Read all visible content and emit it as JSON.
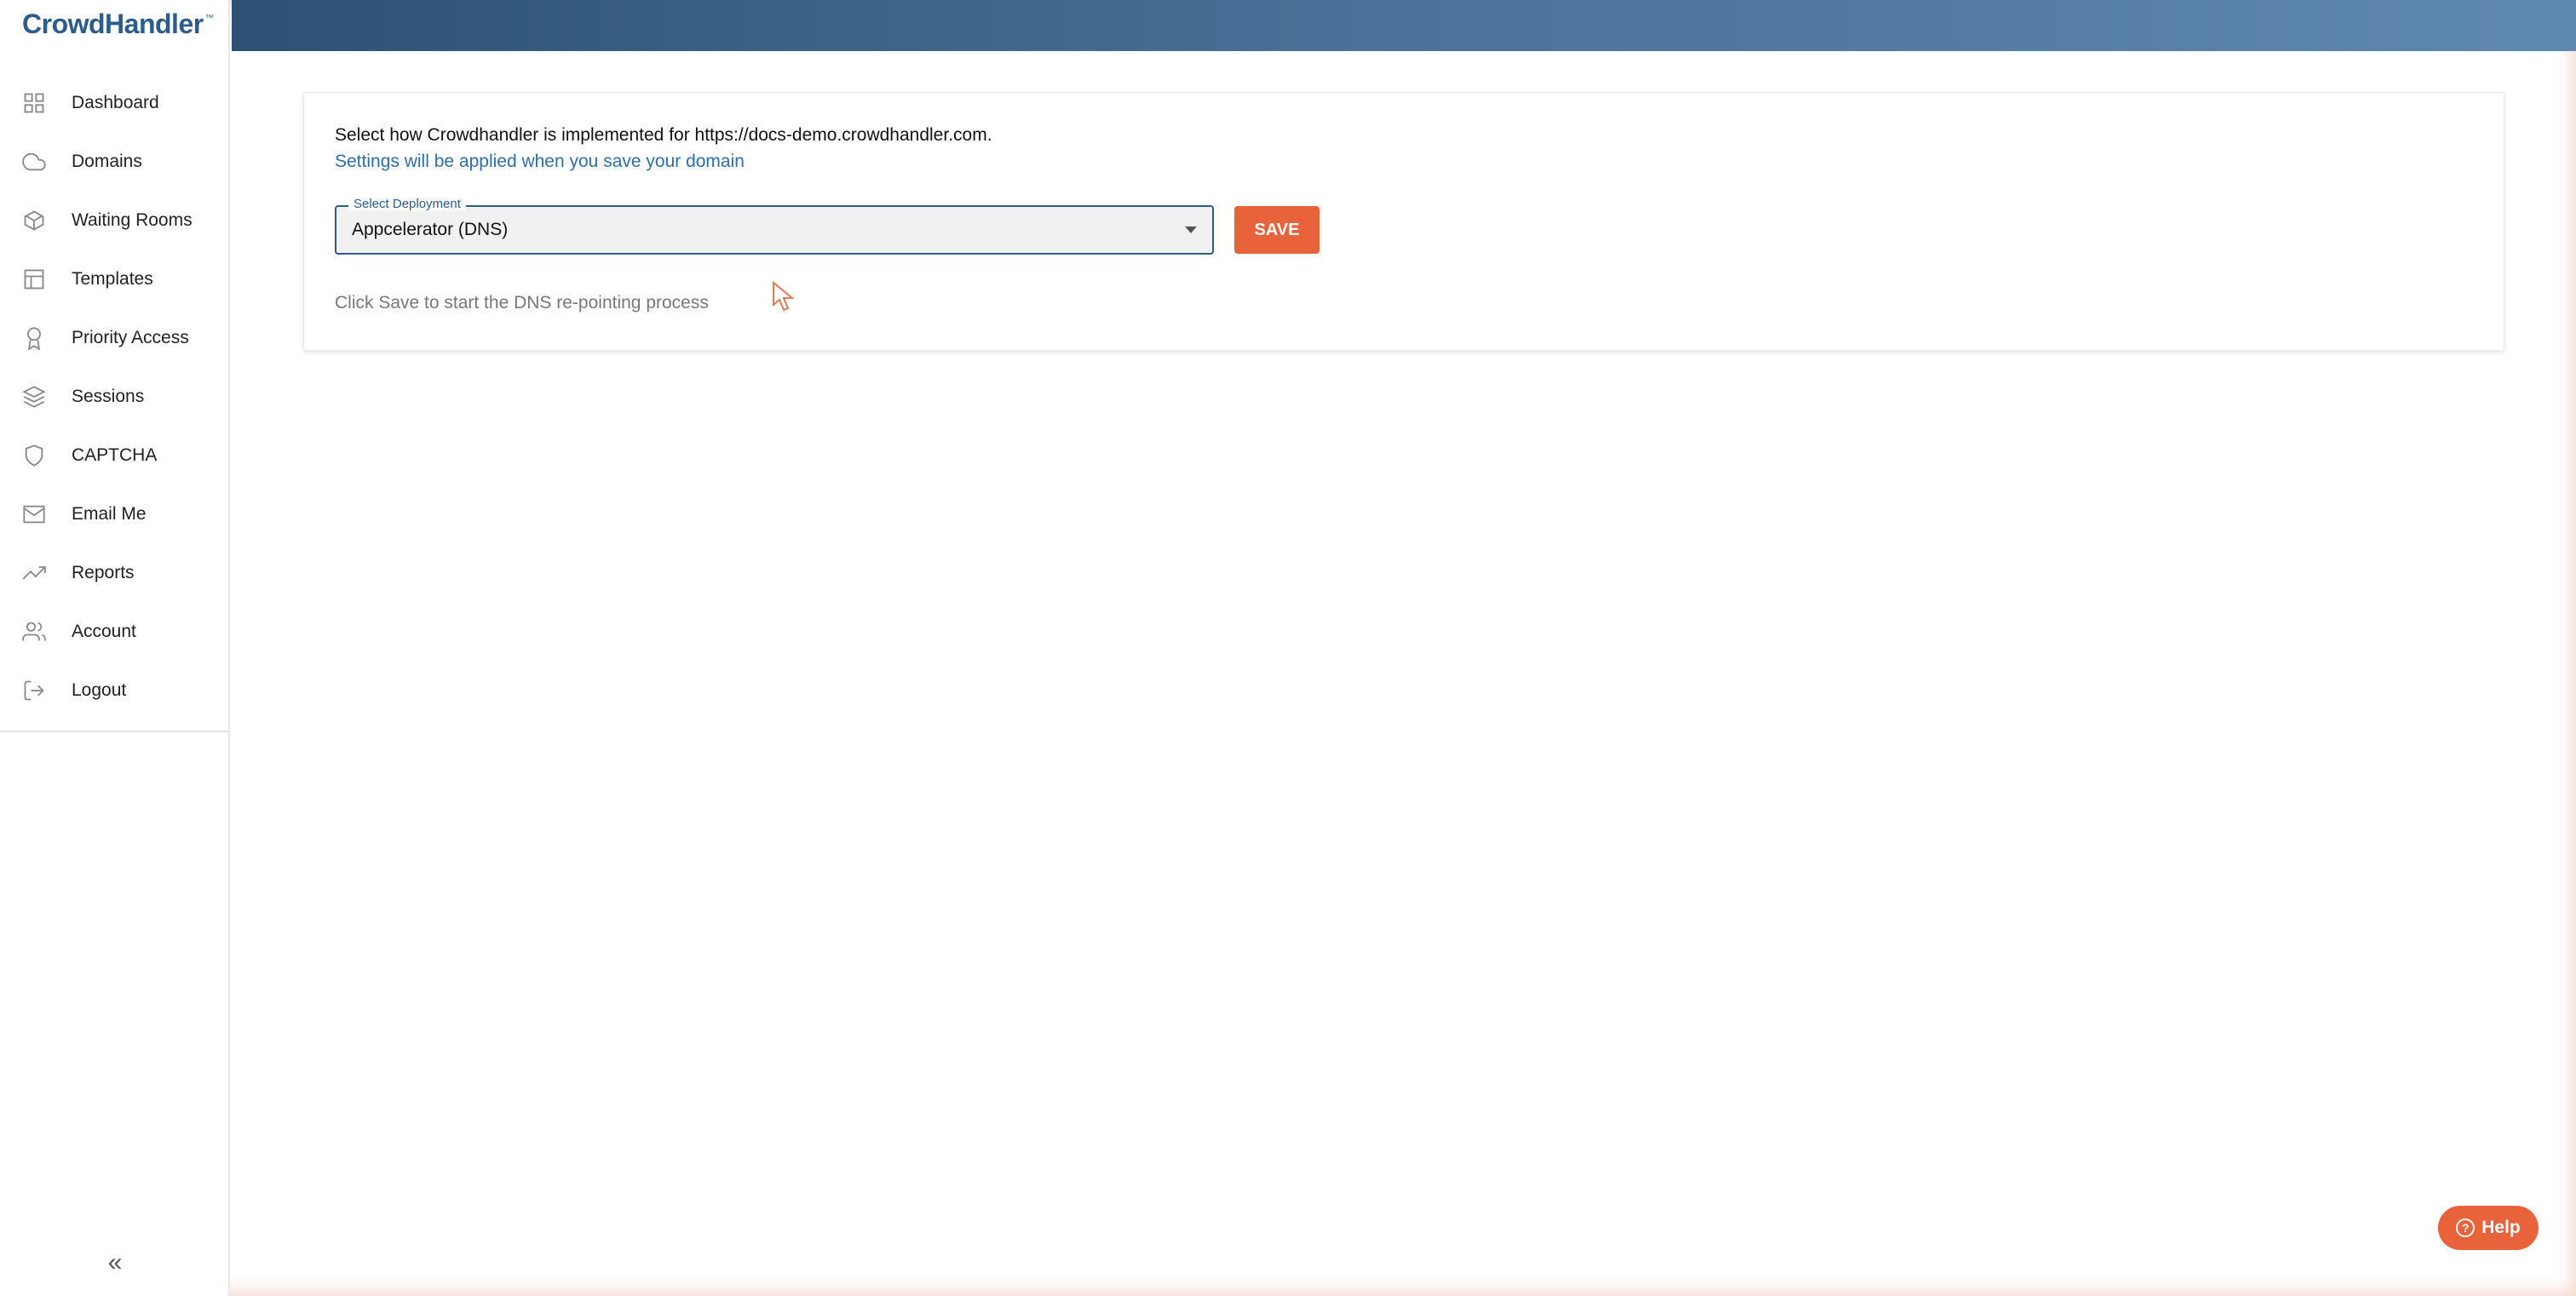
{
  "app": {
    "logo_text": "CrowdHandler",
    "logo_mark": "™"
  },
  "sidebar": {
    "items": [
      {
        "label": "Dashboard",
        "icon": "grid-icon"
      },
      {
        "label": "Domains",
        "icon": "cloud-icon"
      },
      {
        "label": "Waiting Rooms",
        "icon": "cube-icon"
      },
      {
        "label": "Templates",
        "icon": "layout-icon"
      },
      {
        "label": "Priority Access",
        "icon": "award-icon"
      },
      {
        "label": "Sessions",
        "icon": "layers-icon"
      },
      {
        "label": "CAPTCHA",
        "icon": "shield-icon"
      },
      {
        "label": "Email Me",
        "icon": "mail-icon"
      },
      {
        "label": "Reports",
        "icon": "trending-up-icon"
      },
      {
        "label": "Account",
        "icon": "users-icon"
      },
      {
        "label": "Logout",
        "icon": "logout-icon"
      }
    ],
    "collapse_glyph": "«"
  },
  "main": {
    "intro_text": "Select how Crowdhandler is implemented for https://docs-demo.crowdhandler.com.",
    "hint_text": "Settings will be applied when you save your domain",
    "select": {
      "label": "Select Deployment",
      "value": "Appcelerator (DNS)"
    },
    "save_label": "SAVE",
    "status_text": "Click Save to start the DNS re-pointing process"
  },
  "help": {
    "label": "Help",
    "icon_glyph": "?"
  },
  "colors": {
    "brand": "#2c5c8a",
    "accent": "#e8633b",
    "link": "#2f6ea8"
  }
}
